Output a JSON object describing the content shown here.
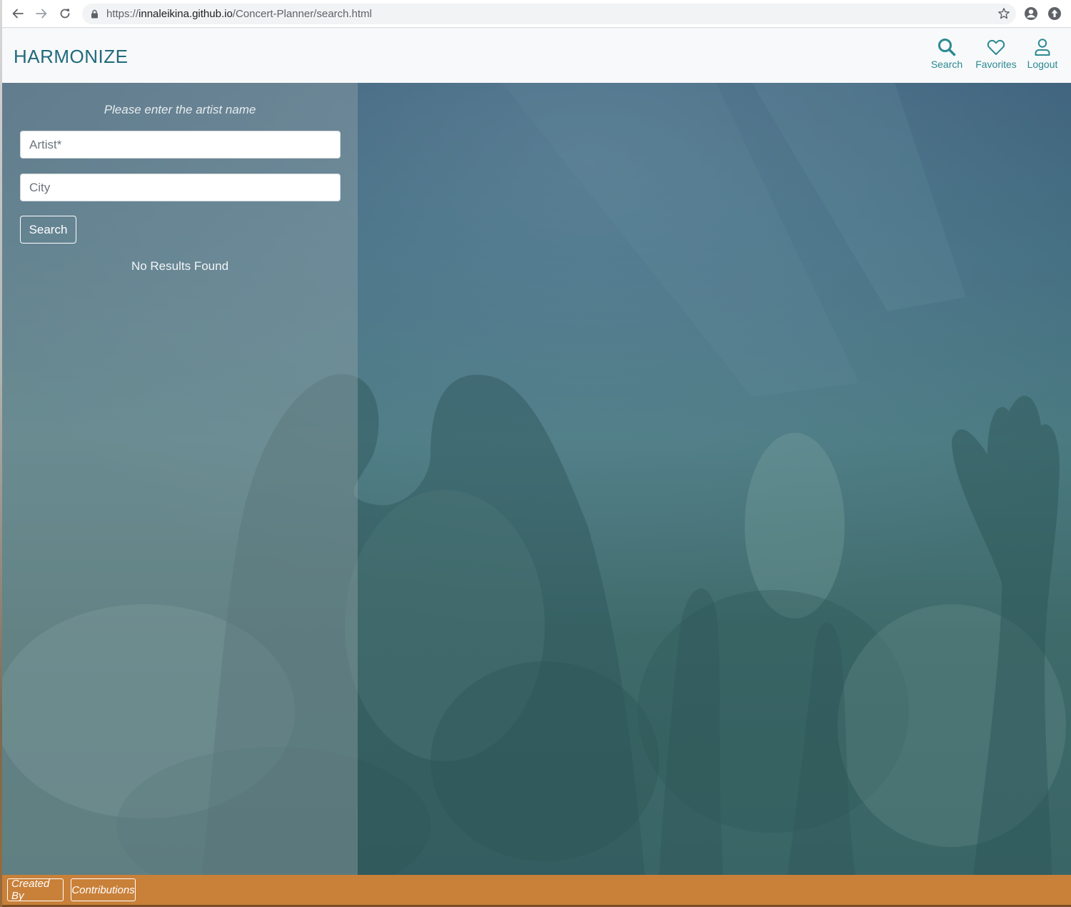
{
  "browser": {
    "url_scheme": "https://",
    "url_host": "innaleikina.github.io",
    "url_path": "/Concert-Planner/search.html",
    "icons": [
      "back-arrow-icon",
      "forward-arrow-icon",
      "reload-icon",
      "lock-icon",
      "star-icon",
      "profile-icon",
      "extension-icon"
    ]
  },
  "header": {
    "brand": "HARMONIZE",
    "nav": [
      {
        "label": "Search",
        "icon": "search-icon"
      },
      {
        "label": "Favorites",
        "icon": "heart-icon"
      },
      {
        "label": "Logout",
        "icon": "user-icon"
      }
    ]
  },
  "search": {
    "prompt": "Please enter the artist name",
    "artist_placeholder": "Artist*",
    "artist_value": "",
    "city_placeholder": "City",
    "city_value": "",
    "button_label": "Search",
    "status": "No Results Found"
  },
  "footer": {
    "created_by": "Created By",
    "contributions": "Contributions"
  },
  "colors": {
    "brand": "#226a7c",
    "nav_accent": "#2a8a92",
    "hero_tint": "#3f6a6e",
    "footer": "#c98039"
  }
}
